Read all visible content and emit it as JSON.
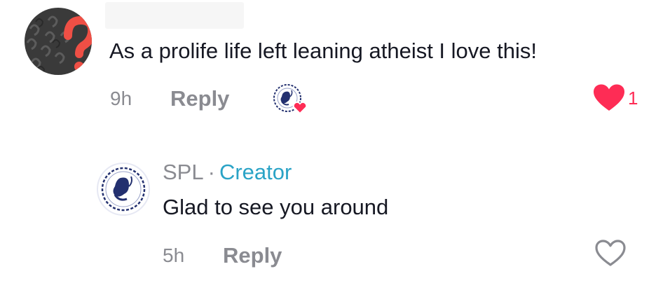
{
  "comment": {
    "text": "As a prolife life left leaning atheist I love this!",
    "time": "9h",
    "reply_label": "Reply",
    "like_count": "1",
    "liked": true,
    "liked_by_creator": true
  },
  "reply_comment": {
    "username": "SPL",
    "separator": "·",
    "badge": "Creator",
    "text": "Glad to see you around",
    "time": "5h",
    "reply_label": "Reply",
    "liked": false
  },
  "colors": {
    "like_red": "#fe2c55",
    "creator_blue": "#2aa3c6",
    "muted_gray": "#8a8b91",
    "text_dark": "#161823",
    "logo_navy": "#23306f"
  },
  "icons": {
    "main_avatar": "question-mark-avatar",
    "creator_avatar": "fetus-dna-logo",
    "liked_by_creator": "creator-heart-badge",
    "like_filled": "heart-filled-icon",
    "like_outline": "heart-outline-icon"
  }
}
